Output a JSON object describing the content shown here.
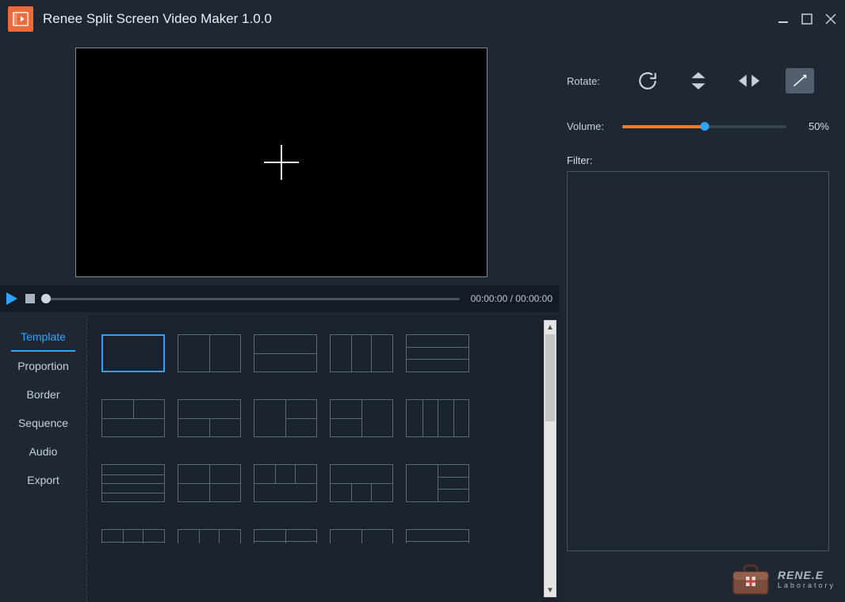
{
  "title": "Renee Split Screen Video Maker 1.0.0",
  "timeline": {
    "time": "00:00:00 / 00:00:00"
  },
  "tabs": [
    {
      "label": "Template",
      "active": true
    },
    {
      "label": "Proportion",
      "active": false
    },
    {
      "label": "Border",
      "active": false
    },
    {
      "label": "Sequence",
      "active": false
    },
    {
      "label": "Audio",
      "active": false
    },
    {
      "label": "Export",
      "active": false
    }
  ],
  "panel": {
    "rotate_label": "Rotate:",
    "volume_label": "Volume:",
    "volume_value": "50%",
    "filter_label": "Filter:"
  },
  "brand": {
    "name": "RENE.E",
    "sub": "Laboratory"
  }
}
